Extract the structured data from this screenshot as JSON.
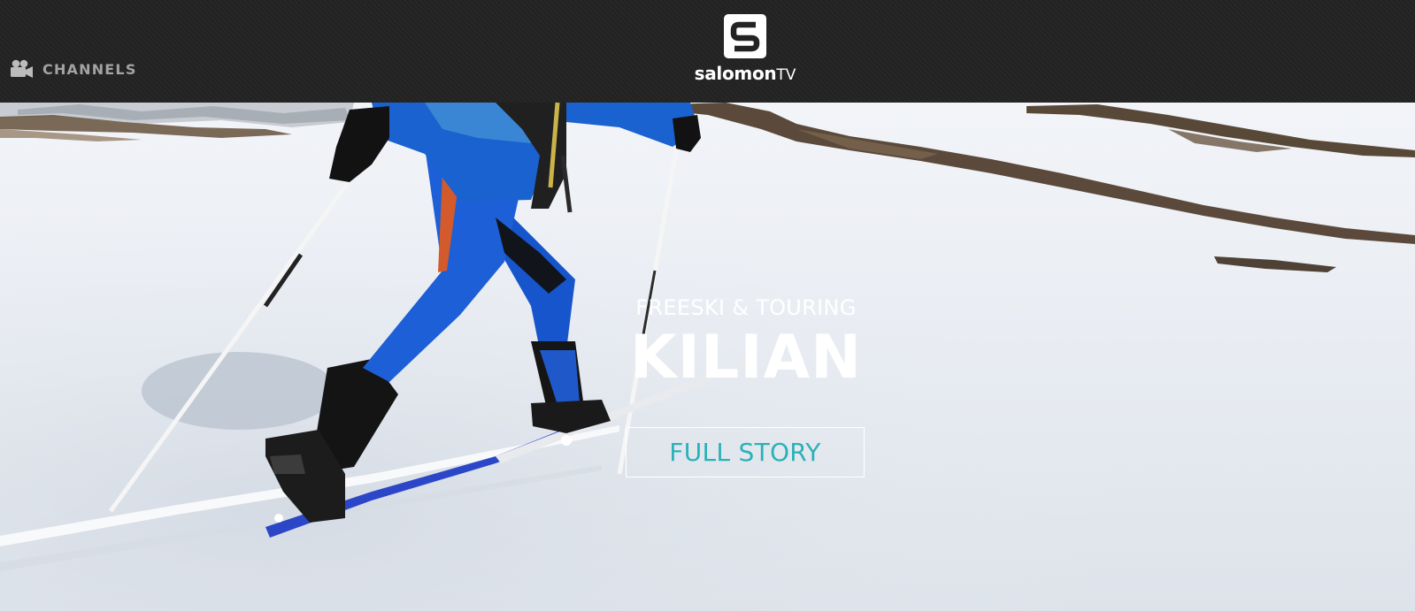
{
  "header": {
    "channels_label": "CHANNELS",
    "channels_icon": "video-camera-icon",
    "logo": {
      "badge_icon": "salomon-s-logo-icon",
      "brand_text": "salomon",
      "tv_text": "TV"
    }
  },
  "hero": {
    "category": "FREESKI & TOURING",
    "title": "KILIAN",
    "cta_label": "FULL STORY",
    "image": "skier-ski-touring-uphill-snow-photo"
  },
  "colors": {
    "header_bg": "#232323",
    "channels_text": "#a3a3a3",
    "cta_text": "#2bb1b8",
    "hero_text": "#ffffff"
  }
}
